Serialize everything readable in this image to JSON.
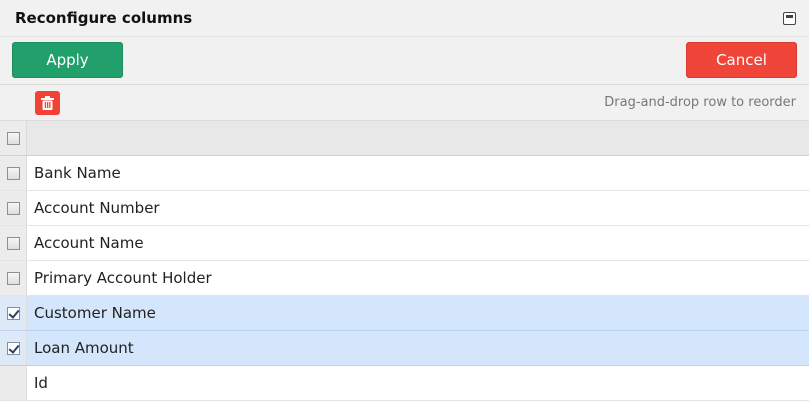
{
  "dialog": {
    "title": "Reconfigure columns"
  },
  "toolbar": {
    "apply_label": "Apply",
    "cancel_label": "Cancel"
  },
  "subbar": {
    "hint": "Drag-and-drop row to reorder"
  },
  "columns": [
    {
      "label": "Bank Name",
      "checked": false
    },
    {
      "label": "Account Number",
      "checked": false
    },
    {
      "label": "Account Name",
      "checked": false
    },
    {
      "label": "Primary Account Holder",
      "checked": false
    },
    {
      "label": "Customer Name",
      "checked": true
    },
    {
      "label": "Loan Amount",
      "checked": true
    },
    {
      "label": "Id",
      "checked": null
    }
  ],
  "colors": {
    "apply": "#22a06b",
    "cancel": "#f0463a",
    "selected_row": "#d3e6fb"
  }
}
